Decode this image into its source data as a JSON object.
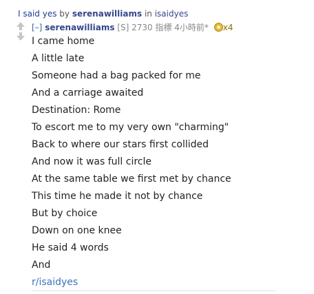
{
  "post": {
    "title": "I said yes",
    "by_label": "by",
    "author": "serenawilliams",
    "in_label": "in",
    "subreddit": "isaidyes"
  },
  "comment": {
    "collapse_toggle": "[–]",
    "author": "serenawilliams",
    "flair": "[S]",
    "points": "2730 指標",
    "time": "4小時前*",
    "gilded_count": "x4",
    "lines": [
      "I came home",
      "A little late",
      "Someone had a bag packed for me",
      "And a carriage awaited",
      "Destination: Rome",
      "To escort me to my very own \"charming\"",
      "Back to where our stars first collided",
      "And now it was full circle",
      "At the same table we first met by chance",
      "This time he made it not by chance",
      "But by choice",
      "Down on one knee",
      "He said 4 words",
      "And"
    ],
    "subreddit_link": "r/isaidyes"
  }
}
